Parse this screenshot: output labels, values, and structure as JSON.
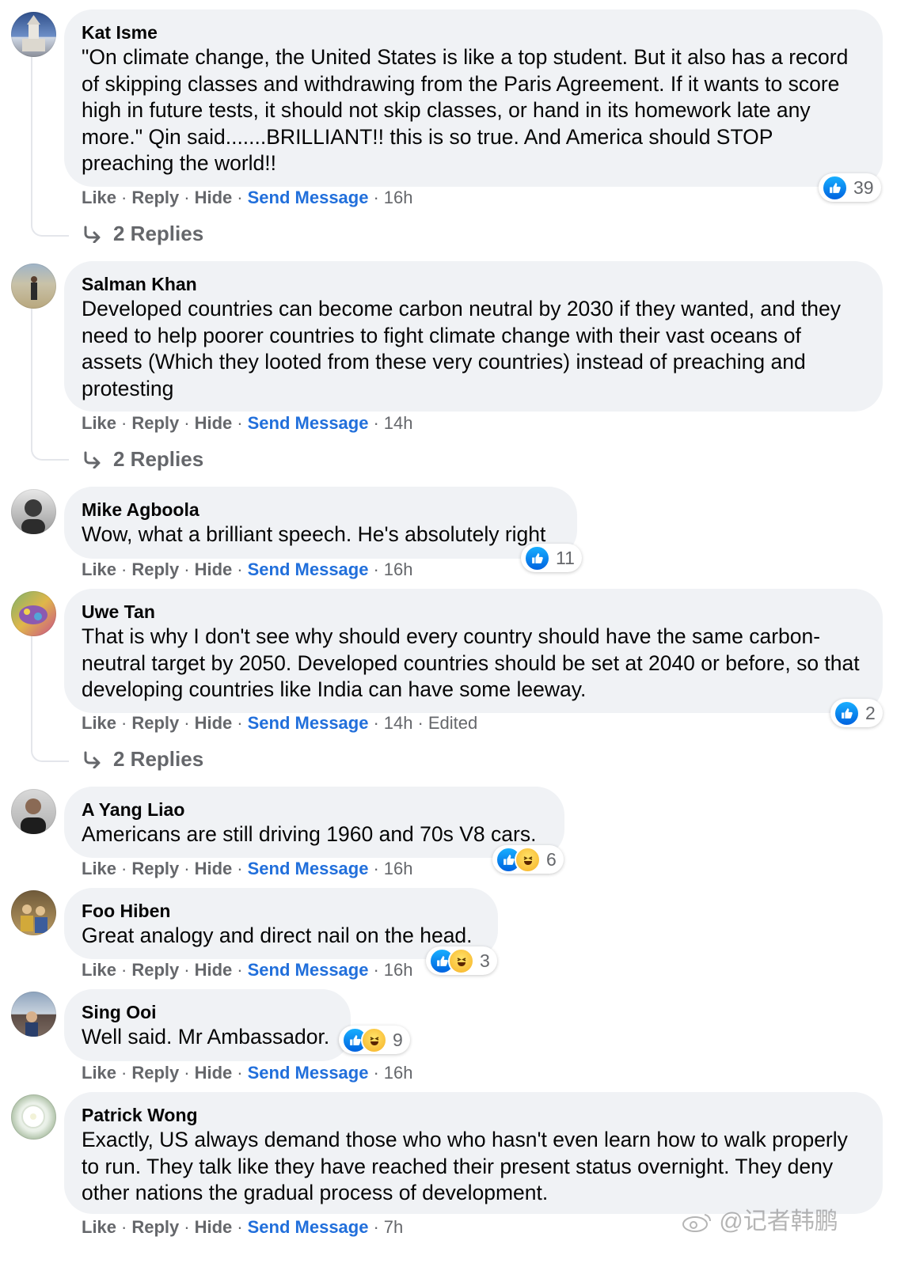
{
  "actions": {
    "like": "Like",
    "reply": "Reply",
    "hide": "Hide",
    "send_message": "Send Message",
    "edited": "Edited"
  },
  "comments": [
    {
      "author": "Kat Isme",
      "text": "\"On climate change, the United States is like a top student. But it also has a record of skipping classes and withdrawing from the Paris Agreement. If it wants to score high in future tests, it should not skip classes, or hand in its homework late any more.\" Qin said.......BRILLIANT!! this is so true. And America should STOP preaching the world!!",
      "time": "16h",
      "reactions": [
        "like-icon"
      ],
      "reaction_count": "39",
      "replies": "2 Replies"
    },
    {
      "author": "Salman Khan",
      "text": "Developed countries can become carbon neutral by 2030 if they wanted, and they need to help poorer countries to fight climate change with their vast oceans of assets (Which they looted from these very countries) instead of preaching and protesting",
      "time": "14h",
      "replies": "2 Replies"
    },
    {
      "author": "Mike Agboola",
      "text": "Wow, what a brilliant speech. He's absolutely right",
      "time": "16h",
      "reactions": [
        "like-icon"
      ],
      "reaction_count": "11"
    },
    {
      "author": "Uwe Tan",
      "text": "That is why I don't see why should every country should have the same carbon-neutral target by 2050. Developed countries should be set at 2040 or before, so that developing countries like India can have some leeway.",
      "time": "14h",
      "edited": true,
      "reactions": [
        "like-icon"
      ],
      "reaction_count": "2",
      "replies": "2 Replies"
    },
    {
      "author": "A Yang Liao",
      "text": "Americans are still driving 1960 and 70s V8 cars.",
      "time": "16h",
      "reactions": [
        "like-icon",
        "haha-icon"
      ],
      "reaction_count": "6"
    },
    {
      "author": "Foo Hiben",
      "text": "Great analogy and direct nail on the head.",
      "time": "16h",
      "reactions": [
        "like-icon",
        "haha-icon"
      ],
      "reaction_count": "3"
    },
    {
      "author": "Sing Ooi",
      "text": "Well said. Mr Ambassador.",
      "time": "16h",
      "reactions": [
        "like-icon",
        "haha-icon"
      ],
      "reaction_count": "9"
    },
    {
      "author": "Patrick Wong",
      "text": "Exactly, US always demand those who who hasn't even learn how to walk properly to run. They talk like they have reached their present status overnight. They deny other nations the gradual process of development.",
      "time": "7h"
    }
  ],
  "watermark": "@记者韩鹏",
  "colors": {
    "bubble": "#f0f2f5",
    "link": "#216fdb",
    "meta": "#65676b"
  }
}
